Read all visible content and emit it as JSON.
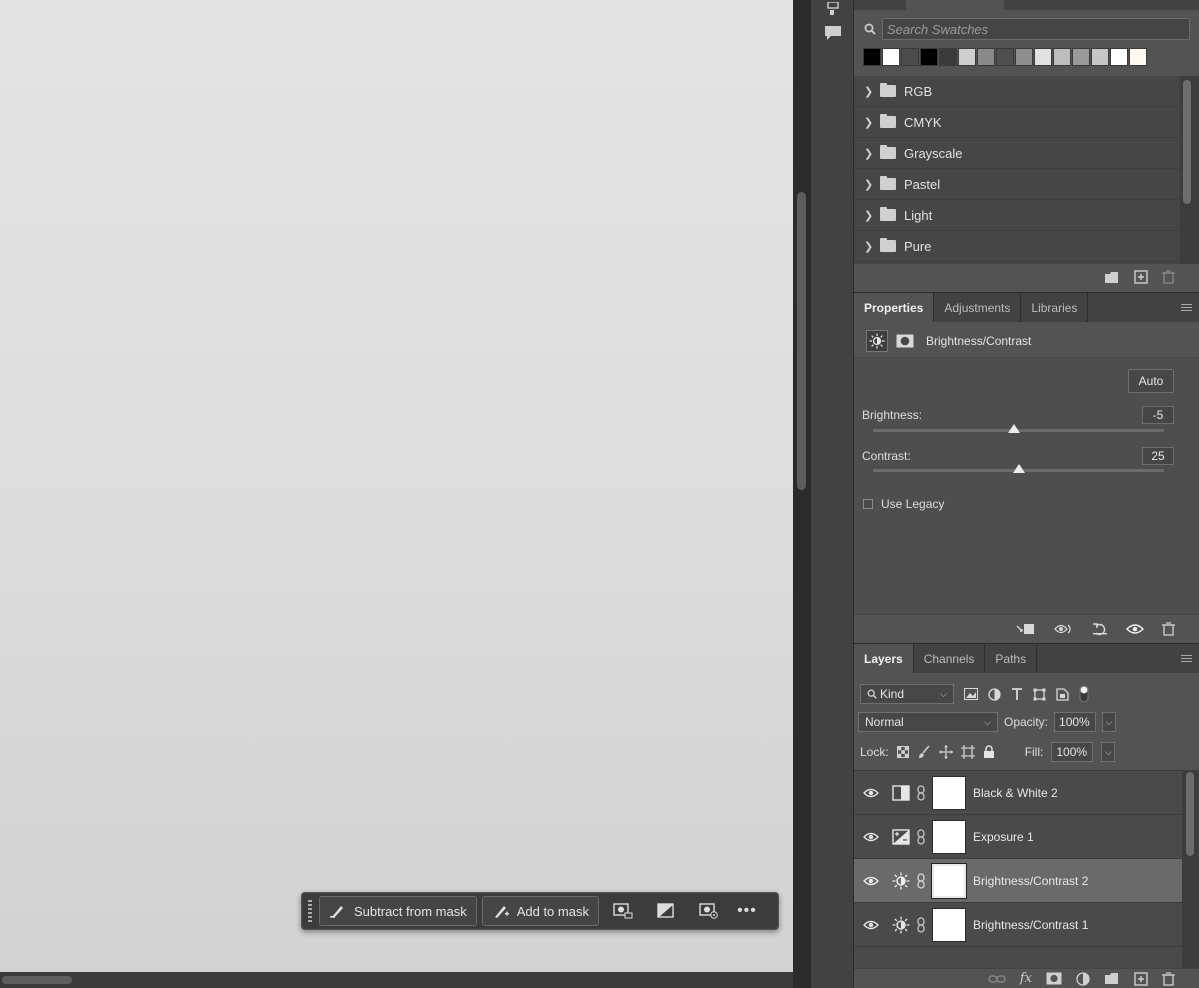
{
  "canvas": {
    "placeholder_note": ""
  },
  "task_bar": {
    "subtract_label": "Subtract from mask",
    "add_label": "Add to mask",
    "more_label": "•••"
  },
  "swatches": {
    "search_placeholder": "Search Swatches",
    "recent_colors": [
      "#000000",
      "#ffffff",
      "#4b4b4b",
      "#000000",
      "#3a3a3a",
      "#cfcfcf",
      "#8a8a8a",
      "#4f4f4f",
      "#8e8e8e",
      "#e2e2e2",
      "#bdbdbd",
      "#9a9a9a",
      "#c6c6c6",
      "#ffffff",
      "#fffaf0"
    ],
    "groups": [
      {
        "label": "RGB"
      },
      {
        "label": "CMYK"
      },
      {
        "label": "Grayscale"
      },
      {
        "label": "Pastel"
      },
      {
        "label": "Light"
      },
      {
        "label": "Pure"
      }
    ]
  },
  "properties": {
    "tabs": [
      {
        "label": "Properties",
        "active": true
      },
      {
        "label": "Adjustments",
        "active": false
      },
      {
        "label": "Libraries",
        "active": false
      }
    ],
    "title": "Brightness/Contrast",
    "auto_label": "Auto",
    "brightness": {
      "label": "Brightness:",
      "value": "-5",
      "min": -150,
      "max": 150,
      "current": -5
    },
    "contrast": {
      "label": "Contrast:",
      "value": "25",
      "min": -50,
      "max": 100,
      "current": 25
    },
    "legacy_label": "Use Legacy",
    "legacy_checked": false
  },
  "layers": {
    "tabs": [
      {
        "label": "Layers",
        "active": true
      },
      {
        "label": "Channels",
        "active": false
      },
      {
        "label": "Paths",
        "active": false
      }
    ],
    "filter_label": "Kind",
    "blend_mode": "Normal",
    "opacity_label": "Opacity:",
    "opacity_value": "100%",
    "lock_label": "Lock:",
    "fill_label": "Fill:",
    "fill_value": "100%",
    "items": [
      {
        "name": "Black & White 2",
        "icon": "black-white-adjustment-icon",
        "selected": false,
        "visible": true
      },
      {
        "name": "Exposure 1",
        "icon": "exposure-adjustment-icon",
        "selected": false,
        "visible": true
      },
      {
        "name": "Brightness/Contrast 2",
        "icon": "brightness-adjustment-icon",
        "selected": true,
        "visible": true
      },
      {
        "name": "Brightness/Contrast 1",
        "icon": "brightness-adjustment-icon",
        "selected": false,
        "visible": true
      }
    ]
  }
}
